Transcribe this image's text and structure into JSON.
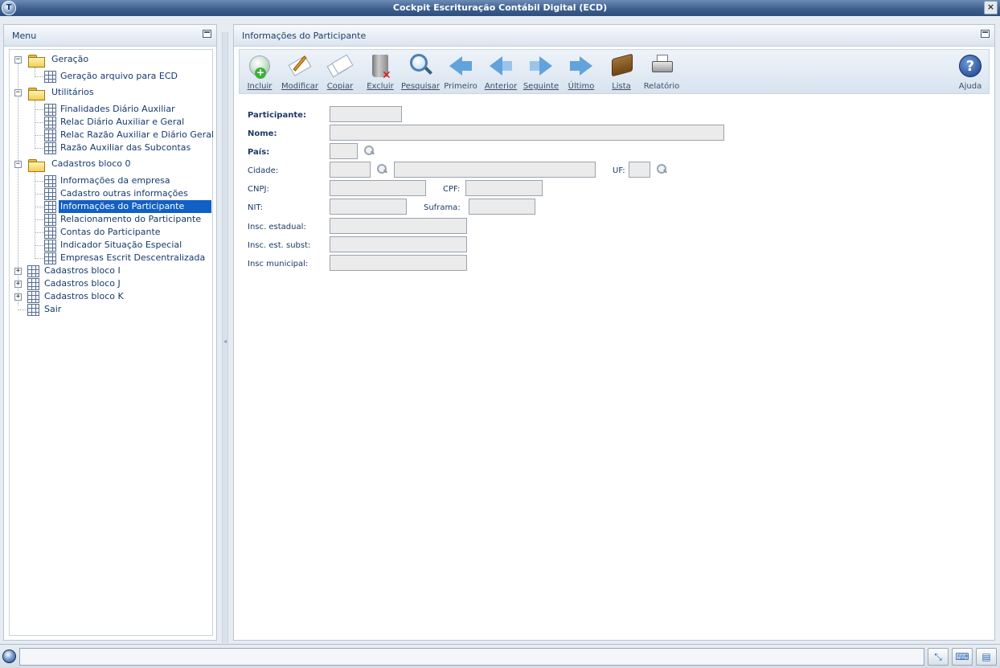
{
  "window": {
    "title": "Cockpit Escrituração Contábil Digital (ECD)",
    "app_icon_letter": "T",
    "close_label": "×"
  },
  "menu": {
    "title": "Menu",
    "items": [
      {
        "label": "Geração"
      },
      {
        "label": "Geração arquivo para ECD"
      },
      {
        "label": "Utilitários"
      },
      {
        "label": "Finalidades Diário Auxiliar"
      },
      {
        "label": "Relac Diário Auxiliar e Geral"
      },
      {
        "label": "Relac Razão Auxiliar e Diário Geral"
      },
      {
        "label": "Razão Auxiliar das Subcontas"
      },
      {
        "label": "Cadastros bloco 0"
      },
      {
        "label": "Informações da empresa"
      },
      {
        "label": "Cadastro outras informações"
      },
      {
        "label": "Informações do Participante"
      },
      {
        "label": "Relacionamento do Participante"
      },
      {
        "label": "Contas do Participante"
      },
      {
        "label": "Indicador Situação Especial"
      },
      {
        "label": "Empresas Escrit Descentralizada"
      },
      {
        "label": "Cadastros bloco I"
      },
      {
        "label": "Cadastros bloco J"
      },
      {
        "label": "Cadastros bloco K"
      },
      {
        "label": "Sair"
      }
    ],
    "expander_open": "−",
    "expander_closed": "+"
  },
  "content": {
    "title": "Informações do Participante",
    "toolbar": {
      "incluir": "Incluir",
      "modificar": "Modificar",
      "copiar": "Copiar",
      "excluir": "Excluir",
      "pesquisar": "Pesquisar",
      "primeiro": "Primeiro",
      "anterior": "Anterior",
      "seguinte": "Seguinte",
      "ultimo": "Último",
      "lista": "Lista",
      "relatorio": "Relatório",
      "ajuda": "Ajuda",
      "help_glyph": "?"
    },
    "form": {
      "participante": {
        "label": "Participante:",
        "value": ""
      },
      "nome": {
        "label": "Nome:",
        "value": ""
      },
      "pais": {
        "label": "País:",
        "value": ""
      },
      "cidade": {
        "label": "Cidade:",
        "code": "",
        "name": ""
      },
      "uf": {
        "label": "UF:",
        "value": ""
      },
      "cnpj": {
        "label": "CNPJ:",
        "value": ""
      },
      "cpf": {
        "label": "CPF:",
        "value": ""
      },
      "nit": {
        "label": "NIT:",
        "value": ""
      },
      "suframa": {
        "label": "Suframa:",
        "value": ""
      },
      "insc_estadual": {
        "label": "Insc. estadual:",
        "value": ""
      },
      "insc_est_subst": {
        "label": "Insc. est. subst:",
        "value": ""
      },
      "insc_municipal": {
        "label": "Insc municipal:",
        "value": ""
      }
    }
  },
  "statusbar": {
    "message": ""
  },
  "colors": {
    "titlebar": "#3e5f8e",
    "selection": "#1160c6",
    "link_text": "#143a6e"
  }
}
